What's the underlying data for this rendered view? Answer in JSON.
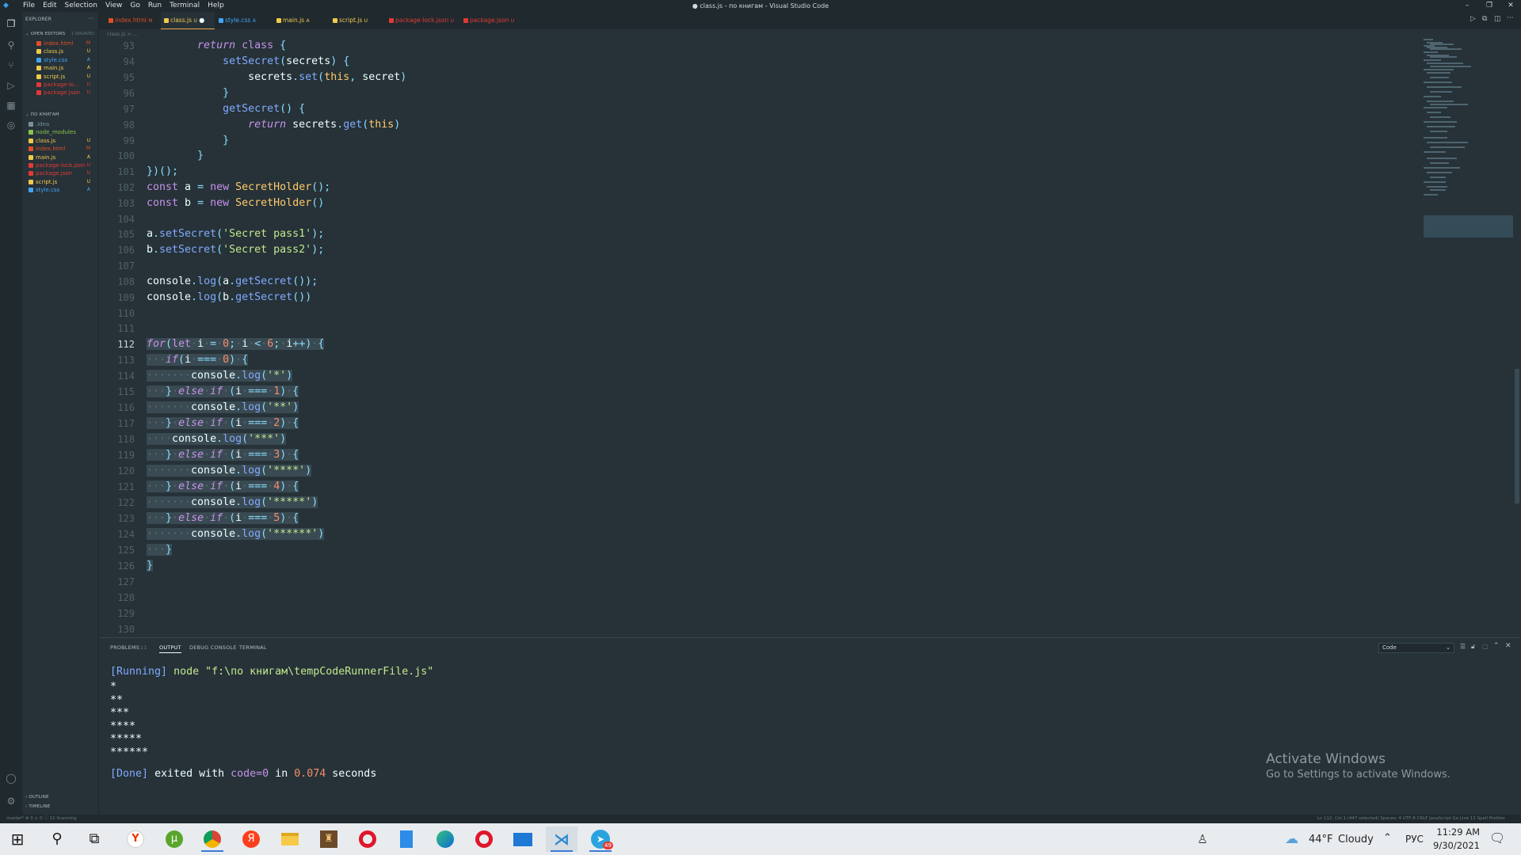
{
  "window": {
    "title": "● class.js - по книгам - Visual Studio Code",
    "menu": [
      "File",
      "Edit",
      "Selection",
      "View",
      "Go",
      "Run",
      "Terminal",
      "Help"
    ]
  },
  "sidebar": {
    "explorer_title": "EXPLORER",
    "open_editors_title": "OPEN EDITORS",
    "open_editors_badge": "1 UNSAVED",
    "open_editors": [
      {
        "name": "index.html",
        "status": "M",
        "color": "#e44d26"
      },
      {
        "name": "class.js",
        "status": "U",
        "color": "#f2c94c"
      },
      {
        "name": "style.css",
        "status": "A",
        "color": "#42a5f5"
      },
      {
        "name": "main.js",
        "status": "A",
        "color": "#f2c94c"
      },
      {
        "name": "script.js",
        "status": "U",
        "color": "#f2c94c"
      },
      {
        "name": "package-lo...",
        "status": "U",
        "color": "#e53935"
      },
      {
        "name": "package.json",
        "status": "U",
        "color": "#e53935"
      }
    ],
    "folder_title": "ПО КНИГАМ",
    "files": [
      {
        "name": ".idea",
        "status": "",
        "color": "#78909c"
      },
      {
        "name": "node_modules",
        "status": "",
        "color": "#8bc34a"
      },
      {
        "name": "class.js",
        "status": "U",
        "color": "#f2c94c"
      },
      {
        "name": "index.html",
        "status": "M",
        "color": "#e44d26"
      },
      {
        "name": "main.js",
        "status": "A",
        "color": "#f2c94c"
      },
      {
        "name": "package-lock.json",
        "status": "U",
        "color": "#e53935"
      },
      {
        "name": "package.json",
        "status": "U",
        "color": "#e53935"
      },
      {
        "name": "script.js",
        "status": "U",
        "color": "#f2c94c"
      },
      {
        "name": "style.css",
        "status": "A",
        "color": "#42a5f5"
      }
    ],
    "outline": "OUTLINE",
    "timeline": "TIMELINE"
  },
  "tabs": [
    {
      "name": "index.html",
      "status": "M",
      "color": "#e44d26",
      "active": false
    },
    {
      "name": "class.js",
      "status": "U",
      "color": "#f2c94c",
      "active": true
    },
    {
      "name": "style.css",
      "status": "A",
      "color": "#42a5f5",
      "active": false
    },
    {
      "name": "main.js",
      "status": "A",
      "color": "#f2c94c",
      "active": false
    },
    {
      "name": "script.js",
      "status": "U",
      "color": "#f2c94c",
      "active": false
    },
    {
      "name": "package-lock.json",
      "status": "U",
      "color": "#e53935",
      "active": false
    },
    {
      "name": "package.json",
      "status": "U",
      "color": "#e53935",
      "active": false
    }
  ],
  "breadcrumb": "class.js > ...",
  "editor": {
    "current_line": 112,
    "first_line": 93,
    "last_line": 130
  },
  "panel": {
    "tabs": [
      "PROBLEMS",
      "OUTPUT",
      "DEBUG CONSOLE",
      "TERMINAL"
    ],
    "problems_count": "11",
    "active_tab": "OUTPUT",
    "selector": "Code",
    "running_tag": "[Running]",
    "running_cmd": "node \"f:\\по книгам\\tempCodeRunnerFile.js\"",
    "output_lines": [
      "*",
      "**",
      "***",
      "****",
      "*****",
      "******"
    ],
    "done_tag": "[Done]",
    "done_text_1": "exited with",
    "done_code": "code=0",
    "done_text_2": "in",
    "done_time": "0.074",
    "done_text_3": "seconds"
  },
  "watermark": {
    "title": "Activate Windows",
    "subtitle": "Go to Settings to activate Windows."
  },
  "statusbar": {
    "left": "master*   ⊗ 0 ⚠ 0   ⓘ 11 Scanning",
    "right": "Ln 112, Col 1 (447 selected)   Spaces: 4   UTF-8   CRLF   JavaScript   Go Live   11 Spell   Prettier"
  },
  "taskbar": {
    "weather_temp": "44°F",
    "weather_text": "Cloudy",
    "lang": "РУС",
    "time": "11:29 AM",
    "date": "9/30/2021",
    "telegram_badge": "49"
  }
}
